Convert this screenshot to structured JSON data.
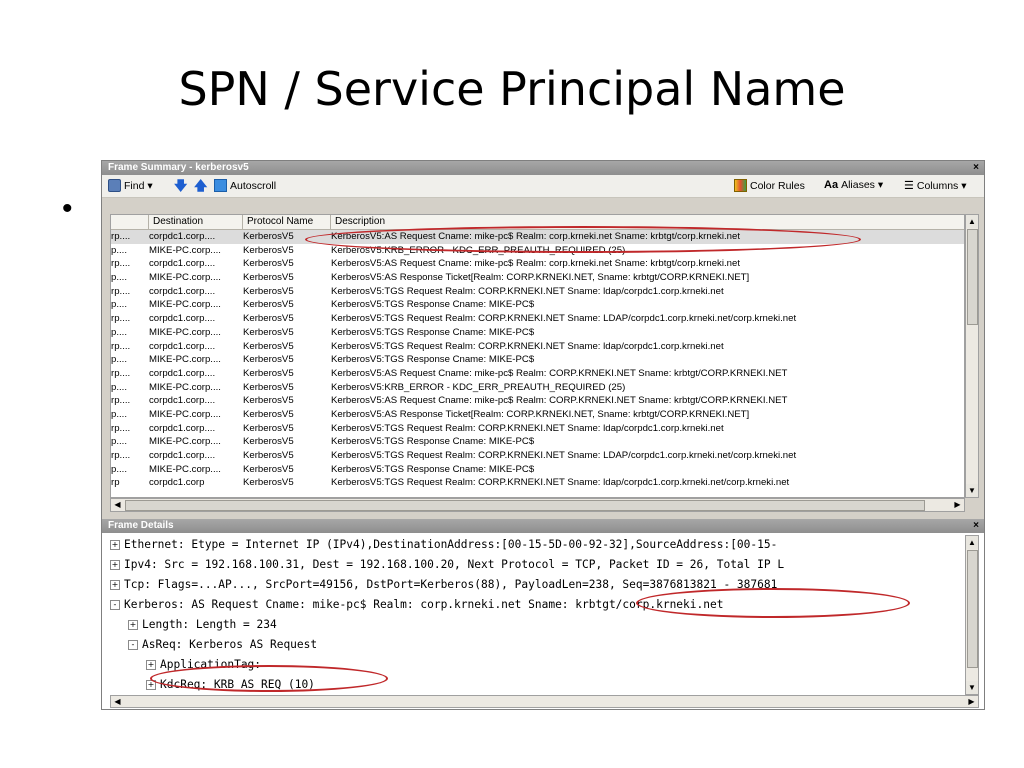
{
  "slide": {
    "title": "SPN / Service Principal Name",
    "bullet": "•"
  },
  "summary": {
    "header": "Frame Summary - kerberosv5",
    "close": "×",
    "toolbar": {
      "find": "Find ▾",
      "autoscroll": "Autoscroll",
      "color_rules": "Color Rules",
      "aliases": "Aliases ▾",
      "columns": "Columns ▾"
    },
    "columns": [
      "Destination",
      "Protocol Name",
      "Description"
    ],
    "rows": [
      {
        "src": "rp....",
        "dst": "corpdc1.corp....",
        "proto": "KerberosV5",
        "desc": "KerberosV5:AS Request Cname: mike-pc$ Realm: corp.krneki.net Sname: krbtgt/corp.krneki.net"
      },
      {
        "src": "p....",
        "dst": "MIKE-PC.corp....",
        "proto": "KerberosV5",
        "desc": "KerberosV5:KRB_ERROR  - KDC_ERR_PREAUTH_REQUIRED (25)"
      },
      {
        "src": "rp....",
        "dst": "corpdc1.corp....",
        "proto": "KerberosV5",
        "desc": "KerberosV5:AS Request Cname: mike-pc$ Realm: corp.krneki.net Sname: krbtgt/corp.krneki.net"
      },
      {
        "src": "p....",
        "dst": "MIKE-PC.corp....",
        "proto": "KerberosV5",
        "desc": "KerberosV5:AS Response Ticket[Realm: CORP.KRNEKI.NET, Sname: krbtgt/CORP.KRNEKI.NET]"
      },
      {
        "src": "rp....",
        "dst": "corpdc1.corp....",
        "proto": "KerberosV5",
        "desc": "KerberosV5:TGS Request Realm: CORP.KRNEKI.NET Sname: ldap/corpdc1.corp.krneki.net"
      },
      {
        "src": "p....",
        "dst": "MIKE-PC.corp....",
        "proto": "KerberosV5",
        "desc": "KerberosV5:TGS Response Cname: MIKE-PC$"
      },
      {
        "src": "rp....",
        "dst": "corpdc1.corp....",
        "proto": "KerberosV5",
        "desc": "KerberosV5:TGS Request Realm: CORP.KRNEKI.NET Sname: LDAP/corpdc1.corp.krneki.net/corp.krneki.net"
      },
      {
        "src": "p....",
        "dst": "MIKE-PC.corp....",
        "proto": "KerberosV5",
        "desc": "KerberosV5:TGS Response Cname: MIKE-PC$"
      },
      {
        "src": "rp....",
        "dst": "corpdc1.corp....",
        "proto": "KerberosV5",
        "desc": "KerberosV5:TGS Request Realm: CORP.KRNEKI.NET Sname: ldap/corpdc1.corp.krneki.net"
      },
      {
        "src": "p....",
        "dst": "MIKE-PC.corp....",
        "proto": "KerberosV5",
        "desc": "KerberosV5:TGS Response Cname: MIKE-PC$"
      },
      {
        "src": "rp....",
        "dst": "corpdc1.corp....",
        "proto": "KerberosV5",
        "desc": "KerberosV5:AS Request Cname: mike-pc$ Realm: CORP.KRNEKI.NET Sname: krbtgt/CORP.KRNEKI.NET"
      },
      {
        "src": "p....",
        "dst": "MIKE-PC.corp....",
        "proto": "KerberosV5",
        "desc": "KerberosV5:KRB_ERROR  - KDC_ERR_PREAUTH_REQUIRED (25)"
      },
      {
        "src": "rp....",
        "dst": "corpdc1.corp....",
        "proto": "KerberosV5",
        "desc": "KerberosV5:AS Request Cname: mike-pc$ Realm: CORP.KRNEKI.NET Sname: krbtgt/CORP.KRNEKI.NET"
      },
      {
        "src": "p....",
        "dst": "MIKE-PC.corp....",
        "proto": "KerberosV5",
        "desc": "KerberosV5:AS Response Ticket[Realm: CORP.KRNEKI.NET, Sname: krbtgt/CORP.KRNEKI.NET]"
      },
      {
        "src": "rp....",
        "dst": "corpdc1.corp....",
        "proto": "KerberosV5",
        "desc": "KerberosV5:TGS Request Realm: CORP.KRNEKI.NET Sname: ldap/corpdc1.corp.krneki.net"
      },
      {
        "src": "p....",
        "dst": "MIKE-PC.corp....",
        "proto": "KerberosV5",
        "desc": "KerberosV5:TGS Response Cname: MIKE-PC$"
      },
      {
        "src": "rp....",
        "dst": "corpdc1.corp....",
        "proto": "KerberosV5",
        "desc": "KerberosV5:TGS Request Realm: CORP.KRNEKI.NET Sname: LDAP/corpdc1.corp.krneki.net/corp.krneki.net"
      },
      {
        "src": "p....",
        "dst": "MIKE-PC.corp....",
        "proto": "KerberosV5",
        "desc": "KerberosV5:TGS Response Cname: MIKE-PC$"
      },
      {
        "src": "rp",
        "dst": "corpdc1.corp",
        "proto": "KerberosV5",
        "desc": "KerberosV5:TGS Request Realm: CORP.KRNEKI.NET Sname: ldap/corpdc1.corp.krneki.net/corp.krneki.net"
      }
    ]
  },
  "details": {
    "header": "Frame Details",
    "close": "×",
    "nodes": [
      {
        "indent": 0,
        "toggle": "+",
        "text": "Ethernet: Etype = Internet IP (IPv4),DestinationAddress:[00-15-5D-00-92-32],SourceAddress:[00-15-"
      },
      {
        "indent": 0,
        "toggle": "+",
        "text": "Ipv4: Src = 192.168.100.31, Dest = 192.168.100.20, Next Protocol = TCP, Packet ID = 26, Total IP L"
      },
      {
        "indent": 0,
        "toggle": "+",
        "text": "Tcp: Flags=...AP..., SrcPort=49156, DstPort=Kerberos(88), PayloadLen=238, Seq=3876813821 - 387681"
      },
      {
        "indent": 0,
        "toggle": "-",
        "text": "Kerberos: AS Request Cname: mike-pc$ Realm: corp.krneki.net Sname: krbtgt/corp.krneki.net"
      },
      {
        "indent": 1,
        "toggle": "+",
        "text": "Length: Length = 234"
      },
      {
        "indent": 1,
        "toggle": "-",
        "text": "AsReq: Kerberos AS Request"
      },
      {
        "indent": 2,
        "toggle": "+",
        "text": "ApplicationTag:"
      },
      {
        "indent": 2,
        "toggle": "+",
        "text": "KdcReq: KRB_AS_REQ (10)"
      }
    ]
  },
  "colors": {
    "highlight_oval": "#c0282a",
    "pane_header": "#9a9a9a"
  }
}
